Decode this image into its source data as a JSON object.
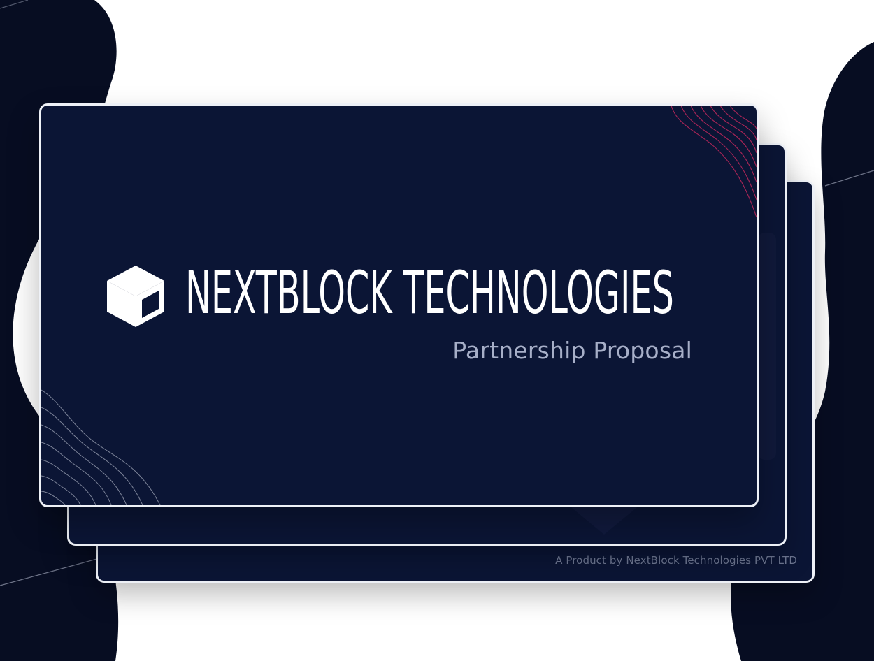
{
  "brand": {
    "name": "NEXTBLOCK TECHNOLOGIES",
    "subtitle": "Partnership Proposal",
    "footer": "A Product by NextBlock Technologies PVT LTD",
    "logo_icon": "cube-icon"
  },
  "colors": {
    "slide_background": "#0b1535",
    "page_background_shapes": "#070d22",
    "slide_border": "#eef1f7",
    "title_text": "#ffffff",
    "subtitle_text": "#a7afc8",
    "footer_text": "#6f7893",
    "accent_lines": "#c6285d"
  }
}
